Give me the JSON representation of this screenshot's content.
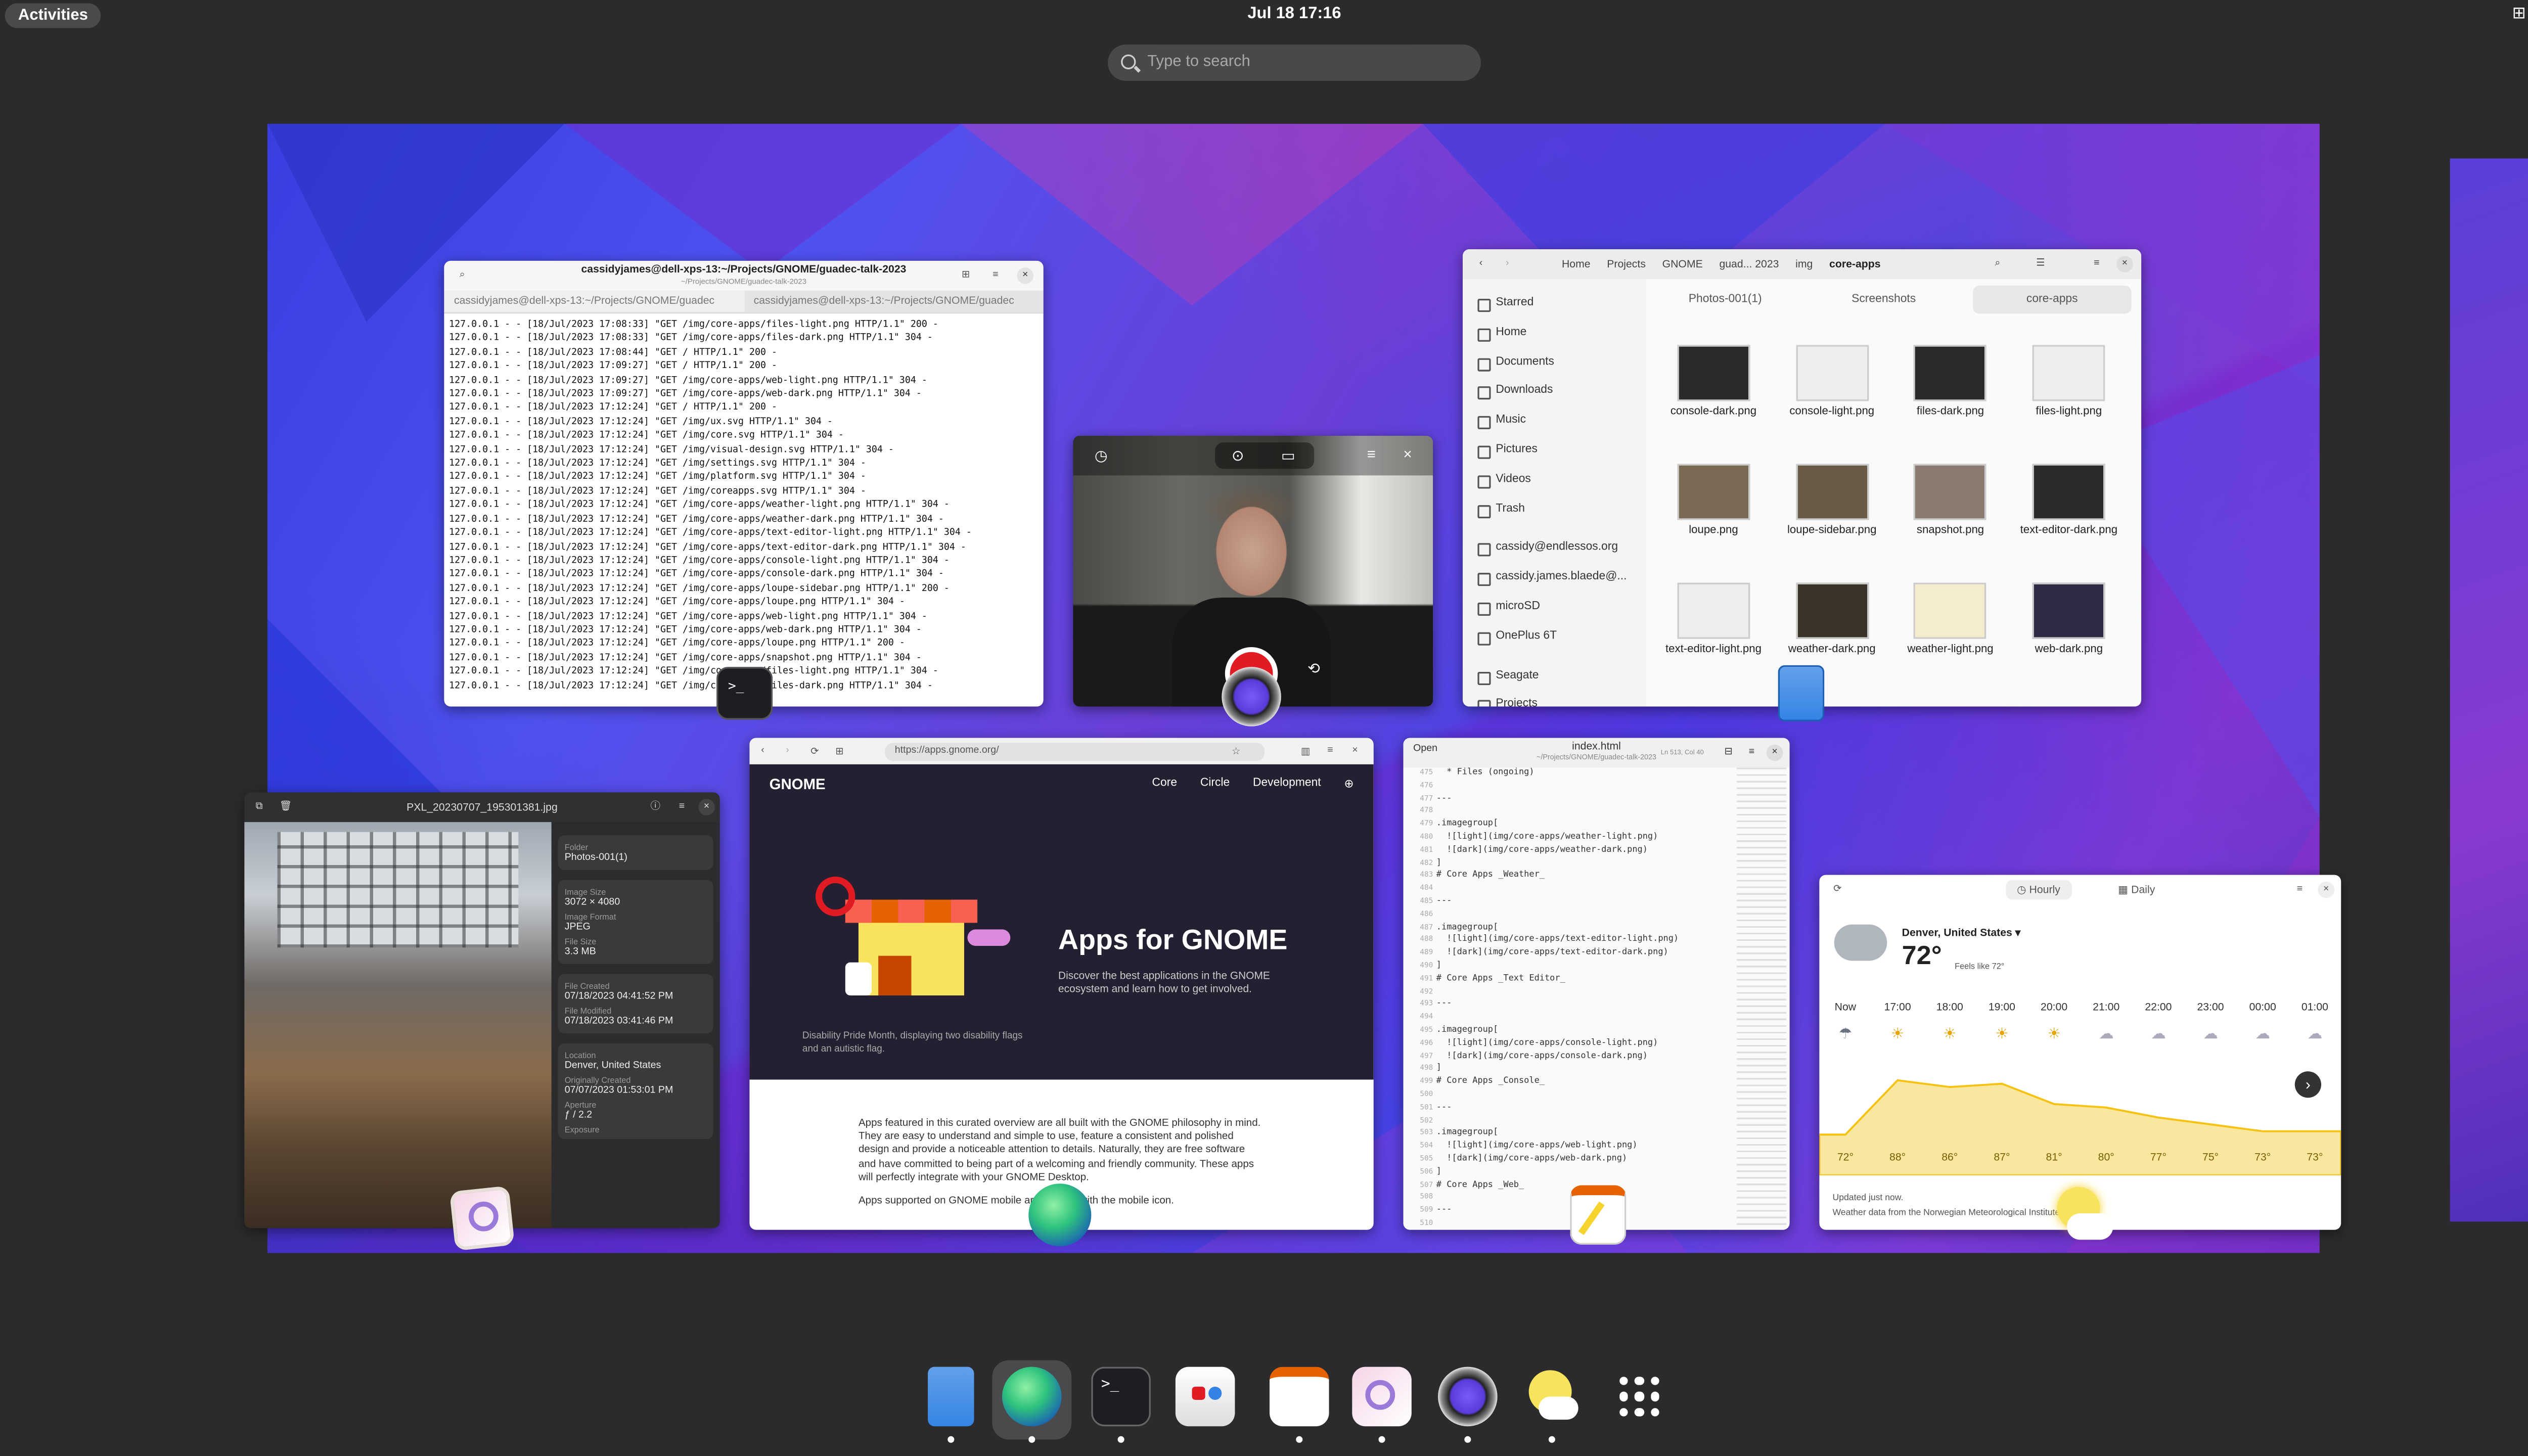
{
  "topbar": {
    "activities": "Activities",
    "clock": "Jul 18  17:16"
  },
  "search": {
    "placeholder": "Type to search"
  },
  "terminal": {
    "title": "cassidyjames@dell-xps-13:~/Projects/GNOME/guadec-talk-2023",
    "subtitle": "~/Projects/GNOME/guadec-talk-2023",
    "tab1": "cassidyjames@dell-xps-13:~/Projects/GNOME/guadec",
    "tab2": "cassidyjames@dell-xps-13:~/Projects/GNOME/guadec",
    "log": "127.0.0.1 - - [18/Jul/2023 17:08:33] \"GET /img/core-apps/files-light.png HTTP/1.1\" 200 -\n127.0.0.1 - - [18/Jul/2023 17:08:33] \"GET /img/core-apps/files-dark.png HTTP/1.1\" 304 -\n127.0.0.1 - - [18/Jul/2023 17:08:44] \"GET / HTTP/1.1\" 200 -\n127.0.0.1 - - [18/Jul/2023 17:09:27] \"GET / HTTP/1.1\" 200 -\n127.0.0.1 - - [18/Jul/2023 17:09:27] \"GET /img/core-apps/web-light.png HTTP/1.1\" 304 -\n127.0.0.1 - - [18/Jul/2023 17:09:27] \"GET /img/core-apps/web-dark.png HTTP/1.1\" 304 -\n127.0.0.1 - - [18/Jul/2023 17:12:24] \"GET / HTTP/1.1\" 200 -\n127.0.0.1 - - [18/Jul/2023 17:12:24] \"GET /img/ux.svg HTTP/1.1\" 304 -\n127.0.0.1 - - [18/Jul/2023 17:12:24] \"GET /img/core.svg HTTP/1.1\" 304 -\n127.0.0.1 - - [18/Jul/2023 17:12:24] \"GET /img/visual-design.svg HTTP/1.1\" 304 -\n127.0.0.1 - - [18/Jul/2023 17:12:24] \"GET /img/settings.svg HTTP/1.1\" 304 -\n127.0.0.1 - - [18/Jul/2023 17:12:24] \"GET /img/platform.svg HTTP/1.1\" 304 -\n127.0.0.1 - - [18/Jul/2023 17:12:24] \"GET /img/coreapps.svg HTTP/1.1\" 304 -\n127.0.0.1 - - [18/Jul/2023 17:12:24] \"GET /img/core-apps/weather-light.png HTTP/1.1\" 304 -\n127.0.0.1 - - [18/Jul/2023 17:12:24] \"GET /img/core-apps/weather-dark.png HTTP/1.1\" 304 -\n127.0.0.1 - - [18/Jul/2023 17:12:24] \"GET /img/core-apps/text-editor-light.png HTTP/1.1\" 304 -\n127.0.0.1 - - [18/Jul/2023 17:12:24] \"GET /img/core-apps/text-editor-dark.png HTTP/1.1\" 304 -\n127.0.0.1 - - [18/Jul/2023 17:12:24] \"GET /img/core-apps/console-light.png HTTP/1.1\" 304 -\n127.0.0.1 - - [18/Jul/2023 17:12:24] \"GET /img/core-apps/console-dark.png HTTP/1.1\" 304 -\n127.0.0.1 - - [18/Jul/2023 17:12:24] \"GET /img/core-apps/loupe-sidebar.png HTTP/1.1\" 200 -\n127.0.0.1 - - [18/Jul/2023 17:12:24] \"GET /img/core-apps/loupe.png HTTP/1.1\" 304 -\n127.0.0.1 - - [18/Jul/2023 17:12:24] \"GET /img/core-apps/web-light.png HTTP/1.1\" 304 -\n127.0.0.1 - - [18/Jul/2023 17:12:24] \"GET /img/core-apps/web-dark.png HTTP/1.1\" 304 -\n127.0.0.1 - - [18/Jul/2023 17:12:24] \"GET /img/core-apps/loupe.png HTTP/1.1\" 200 -\n127.0.0.1 - - [18/Jul/2023 17:12:24] \"GET /img/core-apps/snapshot.png HTTP/1.1\" 304 -\n127.0.0.1 - - [18/Jul/2023 17:12:24] \"GET /img/core-apps/files-light.png HTTP/1.1\" 304 -\n127.0.0.1 - - [18/Jul/2023 17:12:24] \"GET /img/core-apps/files-dark.png HTTP/1.1\" 304 -"
  },
  "files": {
    "path": [
      "Home",
      "Projects",
      "GNOME",
      "guad... 2023",
      "img",
      "core-apps"
    ],
    "sidebar": [
      "Starred",
      "Home",
      "Documents",
      "Downloads",
      "Music",
      "Pictures",
      "Videos",
      "Trash",
      "cassidy@endlessos.org",
      "cassidy.james.blaede@...",
      "microSD",
      "OnePlus 6T",
      "Seagate",
      "Projects"
    ],
    "tabs": [
      "Photos-001(1)",
      "Screenshots",
      "core-apps"
    ],
    "items": [
      "console-dark.png",
      "console-light.png",
      "files-dark.png",
      "files-light.png",
      "loupe.png",
      "loupe-sidebar.png",
      "snapshot.png",
      "text-editor-dark.png",
      "text-editor-light.png",
      "weather-dark.png",
      "weather-light.png",
      "web-dark.png"
    ]
  },
  "loupe": {
    "title": "PXL_20230707_195301381.jpg",
    "props": [
      {
        "k": "Folder",
        "v": "Photos-001(1)"
      },
      {
        "k": "Image Size",
        "v": "3072 × 4080"
      },
      {
        "k": "Image Format",
        "v": "JPEG"
      },
      {
        "k": "File Size",
        "v": "3.3 MB"
      },
      {
        "k": "File Created",
        "v": "07/18/2023 04:41:52 PM"
      },
      {
        "k": "File Modified",
        "v": "07/18/2023 03:41:46 PM"
      },
      {
        "k": "Location",
        "v": "Denver, United States"
      },
      {
        "k": "Originally Created",
        "v": "07/07/2023 01:53:01 PM"
      },
      {
        "k": "Aperture",
        "v": "ƒ / 2.2"
      },
      {
        "k": "Exposure",
        "v": ""
      }
    ]
  },
  "web": {
    "url": "https://apps.gnome.org/",
    "brand": "GNOME",
    "nav": [
      "Core",
      "Circle",
      "Development"
    ],
    "heading": "Apps for GNOME",
    "subtitle": "Discover the best applications in the GNOME ecosystem and learn how to get involved.",
    "caption": "Disability Pride Month, displaying two disability flags and an autistic flag.",
    "body": "Apps featured in this curated overview are all built with the GNOME philosophy in mind. They are easy to understand and simple to use, feature a consistent and polished design and provide a noticeable attention to details. Naturally, they are free software and have committed to being part of a welcoming and friendly community. These apps will perfectly integrate with your GNOME Desktop.",
    "mobile": "Apps supported on GNOME mobile are marked with the mobile icon."
  },
  "editor": {
    "title": "index.html",
    "subtitle": "~/Projects/GNOME/guadec-talk-2023",
    "position": "Ln 513, Col 40",
    "open_label": "Open",
    "code": "  * Files (ongoing)\n\n---\n\n.imagegroup[\n  ![light](img/core-apps/weather-light.png)\n  ![dark](img/core-apps/weather-dark.png)\n]\n# Core Apps _Weather_\n\n---\n\n.imagegroup[\n  ![light](img/core-apps/text-editor-light.png)\n  ![dark](img/core-apps/text-editor-dark.png)\n]\n# Core Apps _Text Editor_\n\n---\n\n.imagegroup[\n  ![light](img/core-apps/console-light.png)\n  ![dark](img/core-apps/console-dark.png)\n]\n# Core Apps _Console_\n\n---\n\n.imagegroup[\n  ![light](img/core-apps/web-light.png)\n  ![dark](img/core-apps/web-dark.png)\n]\n# Core Apps _Web_\n\n---",
    "line_numbers": [
      "475",
      "476",
      "477",
      "478",
      "479",
      "480",
      "481",
      "482",
      "483",
      "484",
      "485",
      "486",
      "487",
      "488",
      "489",
      "490",
      "491",
      "492",
      "493",
      "494",
      "495",
      "496",
      "497",
      "498",
      "499",
      "500",
      "501",
      "502",
      "503",
      "504",
      "505",
      "506",
      "507",
      "508",
      "509",
      "510"
    ]
  },
  "weather": {
    "tabs": [
      "Hourly",
      "Daily"
    ],
    "location": "Denver, United States",
    "temp": "72°",
    "feels": "Feels like 72°",
    "hours": [
      "Now",
      "17:00",
      "18:00",
      "19:00",
      "20:00",
      "21:00",
      "22:00",
      "23:00",
      "00:00",
      "01:00"
    ],
    "temps": [
      "72°",
      "88°",
      "86°",
      "87°",
      "81°",
      "80°",
      "77°",
      "75°",
      "73°",
      "73°"
    ],
    "temps_numeric": [
      72,
      88,
      86,
      87,
      81,
      80,
      77,
      75,
      73,
      73
    ],
    "updated": "Updated just now.",
    "source": "Weather data from the Norwegian Meteorological Institute"
  },
  "dash": {
    "apps": [
      "files-icon",
      "web-browser-icon",
      "terminal-icon",
      "software-icon",
      "text-editor-icon",
      "image-viewer-icon",
      "camera-icon",
      "weather-icon",
      "app-grid-icon"
    ]
  }
}
